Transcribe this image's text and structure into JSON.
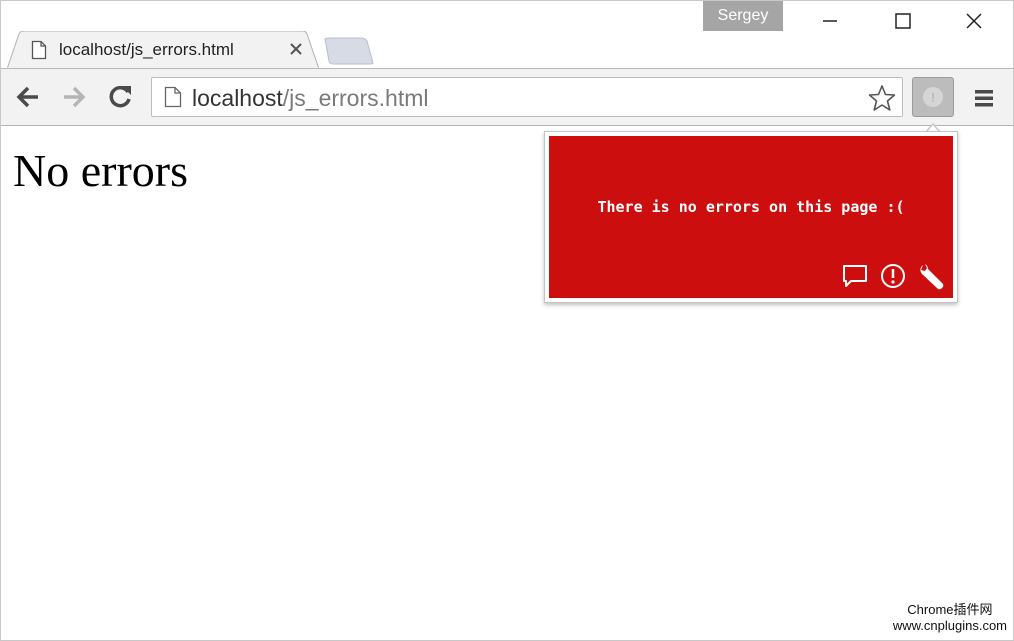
{
  "window": {
    "profile_name": "Sergey"
  },
  "tab": {
    "title": "localhost/js_errors.html"
  },
  "omnibox": {
    "url_host": "localhost",
    "url_path": "/js_errors.html"
  },
  "page": {
    "heading": "No errors"
  },
  "popup": {
    "message": "There is no errors on this page :(",
    "background_color": "#cc0e0e",
    "icons": [
      "comment-icon",
      "alert-circle-icon",
      "wrench-icon"
    ]
  },
  "watermark": {
    "line1": "Chrome插件网",
    "line2": "www.cnplugins.com"
  }
}
